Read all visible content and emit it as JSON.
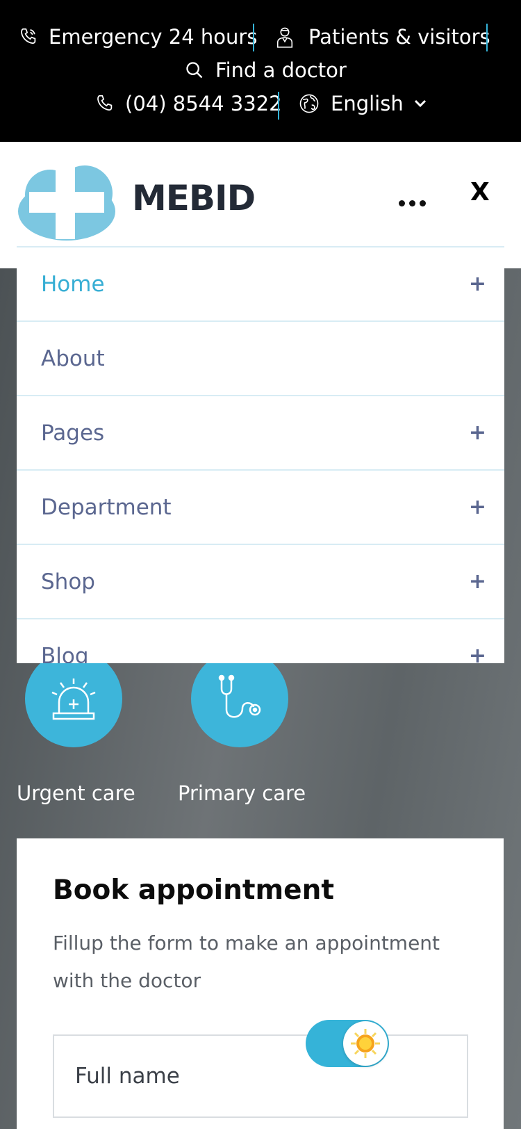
{
  "topbar": {
    "emergency": "Emergency 24 hours",
    "patients": "Patients & visitors",
    "find_doctor": "Find a doctor",
    "phone": "(04) 8544 3322",
    "language": "English"
  },
  "header": {
    "logo_text": "MEBID",
    "close_label": "X"
  },
  "menu": {
    "items": [
      {
        "label": "Home",
        "expand": "+"
      },
      {
        "label": "About",
        "expand": ""
      },
      {
        "label": "Pages",
        "expand": "+"
      },
      {
        "label": "Department",
        "expand": "+"
      },
      {
        "label": "Shop",
        "expand": "+"
      },
      {
        "label": "Blog",
        "expand": "+"
      }
    ]
  },
  "services": [
    {
      "label": "Urgent care",
      "icon": "alarm-light-icon"
    },
    {
      "label": "Primary care",
      "icon": "stethoscope-icon"
    }
  ],
  "appointment": {
    "title": "Book appointment",
    "description": "Fillup the form to make an appointment with the doctor",
    "full_name_placeholder": "Full name"
  },
  "colors": {
    "accent": "#35b3d8",
    "menu_text": "#5b6790",
    "menu_active": "#37aed4",
    "logo_text": "#232a36"
  }
}
